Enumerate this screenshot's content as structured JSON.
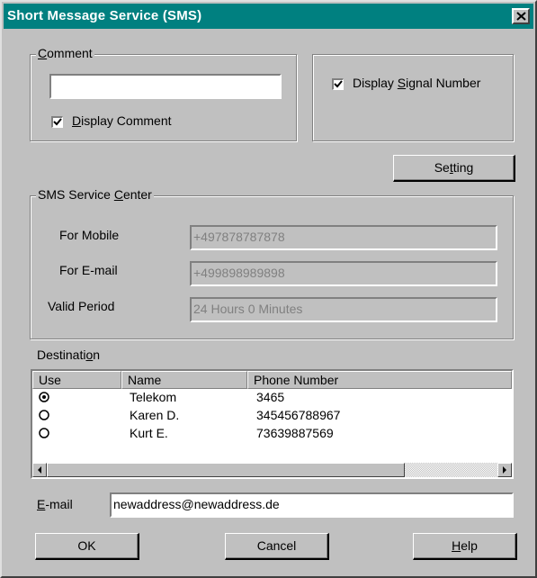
{
  "window": {
    "title": "Short Message Service (SMS)"
  },
  "comment": {
    "legend_pre": "",
    "legend_key": "C",
    "legend_post": "omment",
    "value": "",
    "display_comment": {
      "pre": "",
      "key": "D",
      "post": "isplay Comment",
      "checked": true
    }
  },
  "signal": {
    "display_pre": "Display ",
    "display_key": "S",
    "display_post": "ignal Number",
    "checked": true
  },
  "setting_button": {
    "pre": "Se",
    "key": "t",
    "post": "ting"
  },
  "service_center": {
    "legend_pre": "SMS Service ",
    "legend_key": "C",
    "legend_post": "enter",
    "for_mobile_label": "For Mobile",
    "for_mobile_value": "+497878787878",
    "for_email_label": "For E-mail",
    "for_email_value": "+499898989898",
    "valid_period_label": "Valid Period",
    "valid_period_value": "24 Hours 0 Minutes"
  },
  "destination": {
    "label_pre": "Destinati",
    "label_key": "o",
    "label_post": "n",
    "columns": [
      "Use",
      "Name",
      "Phone Number"
    ],
    "rows": [
      {
        "selected": true,
        "name": "Telekom",
        "phone": "3465"
      },
      {
        "selected": false,
        "name": "Karen D.",
        "phone": "345456788967"
      },
      {
        "selected": false,
        "name": "Kurt E.",
        "phone": "73639887569"
      }
    ]
  },
  "email": {
    "label_key": "E",
    "label_post": "-mail",
    "value": "newaddress@newaddress.de"
  },
  "buttons": {
    "ok": "OK",
    "cancel": "Cancel",
    "help_key": "H",
    "help_post": "elp"
  },
  "colors": {
    "title_bar": "#008080",
    "dialog_face": "#c0c0c0",
    "disabled_text": "#808080"
  }
}
